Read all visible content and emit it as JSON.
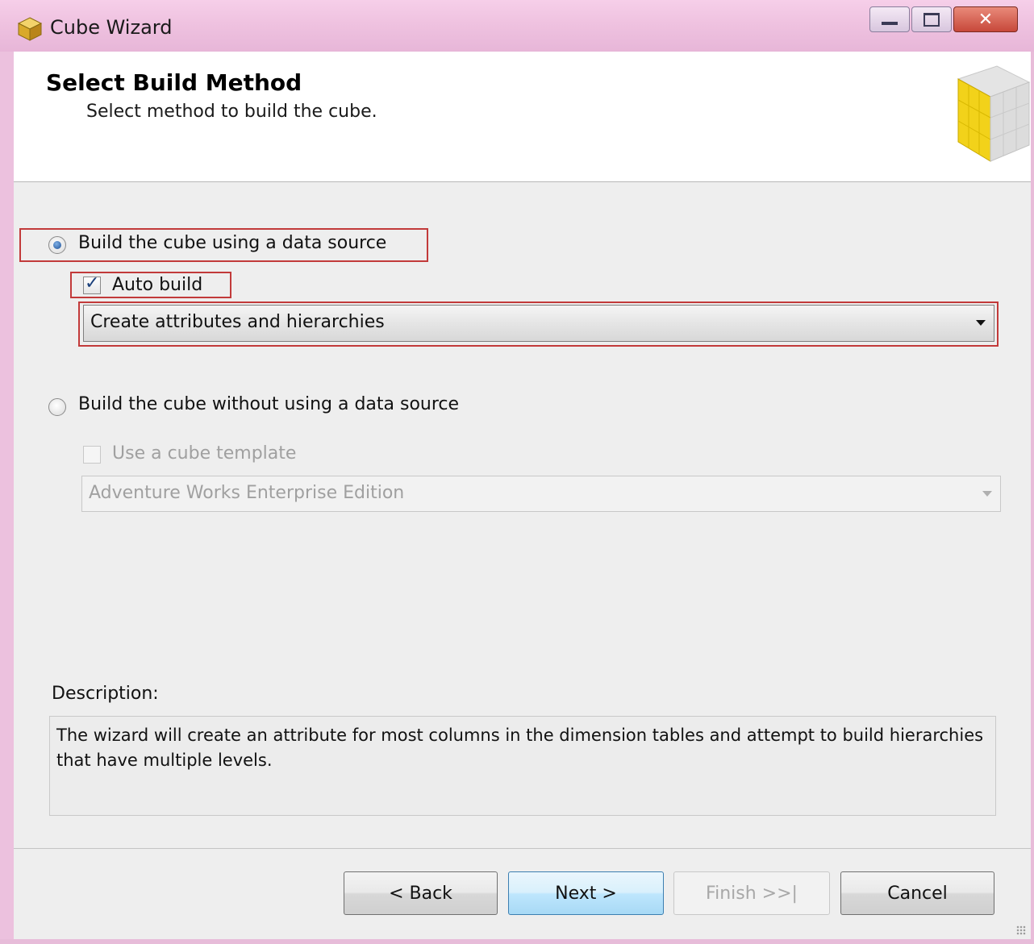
{
  "window": {
    "title": "Cube Wizard",
    "controls": [
      "minimize-icon",
      "maximize-icon",
      "close-icon"
    ]
  },
  "header": {
    "title": "Select Build Method",
    "subtitle": "Select method to build the cube."
  },
  "options": {
    "use_data_source": {
      "label": "Build the cube using a data source",
      "selected": true
    },
    "auto_build": {
      "label": "Auto build",
      "checked": true
    },
    "auto_build_mode": {
      "value": "Create attributes and hierarchies"
    },
    "without_data_source": {
      "label": "Build the cube without using a data source",
      "selected": false
    },
    "use_template": {
      "label": "Use a cube template",
      "checked": false,
      "enabled": false
    },
    "template": {
      "value": "Adventure Works Enterprise Edition",
      "enabled": false
    }
  },
  "description": {
    "label": "Description:",
    "text": "The wizard will create an attribute for most columns in the dimension tables and attempt to build hierarchies that have multiple levels."
  },
  "buttons": {
    "back": "< Back",
    "next": "Next >",
    "finish": "Finish >>|",
    "cancel": "Cancel"
  },
  "colors": {
    "highlight": "#c23a3a",
    "titlebar": "#efc2e0",
    "default_button": "#3c7fb1"
  }
}
